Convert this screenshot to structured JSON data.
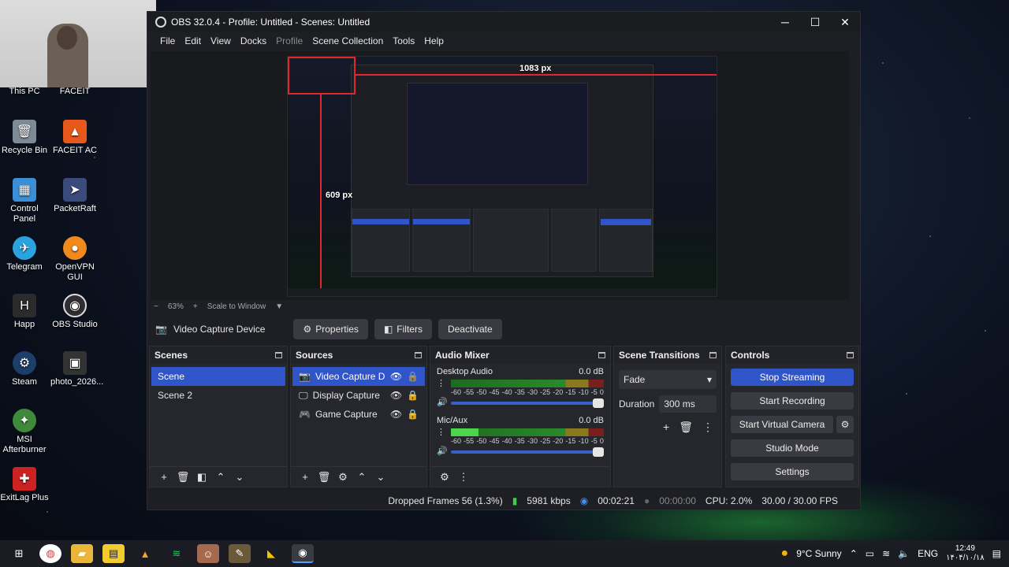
{
  "desktop": {
    "icons": [
      {
        "label": "This PC",
        "icon": "this-pc-icon"
      },
      {
        "label": "FACEIT",
        "icon": "faceit-icon"
      },
      {
        "label": "Recycle Bin",
        "icon": "recycle-bin-icon"
      },
      {
        "label": "FACEIT AC",
        "icon": "faceit-ac-icon"
      },
      {
        "label": "Control Panel",
        "icon": "control-panel-icon"
      },
      {
        "label": "PacketRaft",
        "icon": "packetraft-icon"
      },
      {
        "label": "Telegram",
        "icon": "telegram-icon"
      },
      {
        "label": "OpenVPN GUI",
        "icon": "openvpn-icon"
      },
      {
        "label": "Happ",
        "icon": "happ-icon"
      },
      {
        "label": "OBS Studio",
        "icon": "obs-icon"
      },
      {
        "label": "Steam",
        "icon": "steam-icon"
      },
      {
        "label": "photo_2026...",
        "icon": "photo-icon"
      },
      {
        "label": "MSI Afterburner",
        "icon": "msi-afterburner-icon"
      },
      {
        "label": "ExitLag Plus",
        "icon": "exitlag-icon"
      }
    ]
  },
  "window": {
    "title": "OBS 32.0.4 - Profile: Untitled - Scenes: Untitled",
    "controls": {
      "minimize": "─",
      "maximize": "☐",
      "close": "✕"
    }
  },
  "menu": {
    "items": [
      "File",
      "Edit",
      "View",
      "Docks",
      "Profile",
      "Scene Collection",
      "Tools",
      "Help"
    ]
  },
  "preview": {
    "width_label": "1083 px",
    "height_label": "609 px",
    "zoom": "63%",
    "zoom_minus": "−",
    "zoom_plus": "+",
    "scale_mode": "Scale to Window"
  },
  "context_bar": {
    "source_name": "Video Capture Device",
    "properties_label": "Properties",
    "filters_label": "Filters",
    "deactivate_label": "Deactivate"
  },
  "scenes": {
    "title": "Scenes",
    "items": [
      "Scene",
      "Scene 2"
    ],
    "selected": "Scene"
  },
  "sources": {
    "title": "Sources",
    "items": [
      {
        "name": "Video Capture Devic",
        "icon": "camera-icon"
      },
      {
        "name": "Display Capture",
        "icon": "monitor-icon"
      },
      {
        "name": "Game Capture",
        "icon": "gamepad-icon"
      }
    ]
  },
  "audio_mixer": {
    "title": "Audio Mixer",
    "channels": [
      {
        "name": "Desktop Audio",
        "db": "0.0 dB",
        "level": 0.0
      },
      {
        "name": "Mic/Aux",
        "db": "0.0 dB",
        "level": 0.18
      }
    ],
    "scale": [
      "-60",
      "-55",
      "-50",
      "-45",
      "-40",
      "-35",
      "-30",
      "-25",
      "-20",
      "-15",
      "-10",
      "-5",
      "0"
    ]
  },
  "transitions": {
    "title": "Scene Transitions",
    "selected": "Fade",
    "duration_label": "Duration",
    "duration_value": "300 ms"
  },
  "controls": {
    "title": "Controls",
    "stop_streaming": "Stop Streaming",
    "start_recording": "Start Recording",
    "start_virtual_camera": "Start Virtual Camera",
    "studio_mode": "Studio Mode",
    "settings": "Settings"
  },
  "status": {
    "dropped_frames": "Dropped Frames 56 (1.3%)",
    "bitrate": "5981 kbps",
    "stream_time": "00:02:21",
    "record_time": "00:00:00",
    "cpu": "CPU: 2.0%",
    "fps": "30.00 / 30.00 FPS"
  },
  "taskbar": {
    "weather": "9°C  Sunny",
    "lang": "ENG",
    "time": "12:49",
    "date": "۱۴۰۴/۱۰/۱۸"
  },
  "colors": {
    "accent": "#2f55c8",
    "recording_line": "#e0262e",
    "meter_green": "#4cd44c"
  }
}
